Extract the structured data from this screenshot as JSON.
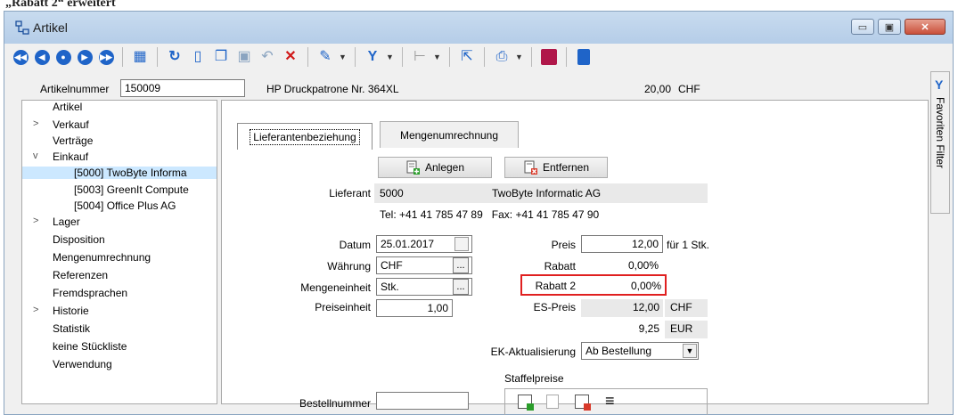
{
  "caption": "„Rabatt 2“ erweitert",
  "window": {
    "title": "Artikel",
    "buttons": {
      "minimize": "▭",
      "maximize": "▣",
      "close": "✕"
    }
  },
  "toolbar": {
    "icons": [
      "first-record-icon",
      "previous-record-icon",
      "reset-icon",
      "next-record-icon",
      "last-record-icon",
      "table-view-icon",
      "refresh-icon",
      "new-document-icon",
      "copy-document-icon",
      "save-icon",
      "undo-icon",
      "delete-icon",
      "pen-icon",
      "filter-icon",
      "tree-icon",
      "cursor-select-icon",
      "print-icon",
      "app-icon",
      "blue-document-icon"
    ]
  },
  "header": {
    "artikelnummer_label": "Artikelnummer",
    "artikelnummer_value": "150009",
    "description": "HP Druckpatrone Nr. 364XL",
    "price": "20,00",
    "currency": "CHF"
  },
  "right_sidebar": {
    "label": "Favoriten Filter"
  },
  "tree": {
    "items": [
      {
        "label": "Artikel"
      },
      {
        "label": "Verkauf",
        "chevron": ">"
      },
      {
        "label": "Verträge"
      },
      {
        "label": "Einkauf",
        "chevron": "v"
      },
      {
        "label": "[5000]  TwoByte Informa"
      },
      {
        "label": "[5003]  GreenIt Compute"
      },
      {
        "label": "[5004]  Office Plus AG"
      },
      {
        "label": "Lager",
        "chevron": ">"
      },
      {
        "label": "Disposition"
      },
      {
        "label": "Mengenumrechnung"
      },
      {
        "label": "Referenzen"
      },
      {
        "label": "Fremdsprachen"
      },
      {
        "label": "Historie",
        "chevron": ">"
      },
      {
        "label": "Statistik"
      },
      {
        "label": "keine Stückliste"
      },
      {
        "label": "Verwendung"
      }
    ]
  },
  "tabs": [
    {
      "label": "Lieferantenbeziehung",
      "active": true
    },
    {
      "label": "Mengenumrechnung",
      "active": false
    }
  ],
  "actions": {
    "anlegen": "Anlegen",
    "entfernen": "Entfernen"
  },
  "lieferant": {
    "label": "Lieferant",
    "number": "5000",
    "name": "TwoByte Informatic AG",
    "contact": "Tel: +41 41 785 47 89   Fax: +41 41 785 47 90"
  },
  "form": {
    "datum_label": "Datum",
    "datum_value": "25.01.2017",
    "waehrung_label": "Währung",
    "waehrung_value": "CHF",
    "mengeneinheit_label": "Mengeneinheit",
    "mengeneinheit_value": "Stk.",
    "preiseinheit_label": "Preiseinheit",
    "preiseinheit_value": "1,00",
    "preis_label": "Preis",
    "preis_value": "12,00",
    "preis_suffix": "für 1 Stk.",
    "rabatt_label": "Rabatt",
    "rabatt_value": "0,00%",
    "rabatt2_label": "Rabatt 2",
    "rabatt2_value": "0,00%",
    "espreis_label": "ES-Preis",
    "espreis_value": "12,00",
    "espreis_currency": "CHF",
    "espreis_eur_value": "9,25",
    "espreis_eur_currency": "EUR",
    "ek_label": "EK-Aktualisierung",
    "ek_value": "Ab Bestellung",
    "bestellnummer_label": "Bestellnummer",
    "staffelpreise_label": "Staffelpreise"
  },
  "colors": {
    "highlight": "#e02020",
    "selection": "#cce8ff",
    "nav_blue": "#1f64c8"
  }
}
